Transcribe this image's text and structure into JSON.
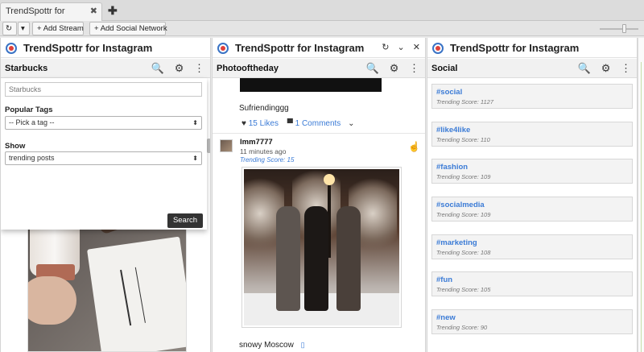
{
  "tab": {
    "label": "TrendSpottr for Instagram",
    "close": "✖",
    "add": "✚"
  },
  "toolbar": {
    "refresh": "↻",
    "dropdown": "▾",
    "add_stream": "Add Stream",
    "add_social": "Add Social Network"
  },
  "brand": {
    "title": "TrendSpottr for Instagram"
  },
  "icons": {
    "search": "🔍",
    "gear": "⚙",
    "more": "⋮",
    "refresh": "↻",
    "chevron": "⌄",
    "close": "✕",
    "plus": "+"
  },
  "col1": {
    "stream": "Starbucks",
    "search_placeholder": "Starbucks",
    "popular_tags_label": "Popular Tags",
    "tag_select": "-- Pick a tag --",
    "show_label": "Show",
    "show_select": "trending posts",
    "search_button": "Search"
  },
  "col2": {
    "stream": "Photooftheday",
    "post1": {
      "caption": "Sufriendinggg",
      "likes": "15 Likes",
      "comments": "1 Comments"
    },
    "post2": {
      "user": "lmm7777",
      "time": "11 minutes ago",
      "score": "Trending Score: 15",
      "caption": "snowy Moscow"
    }
  },
  "col3": {
    "stream": "Social",
    "tags": [
      {
        "name": "#social",
        "score": "Trending Score: 1127"
      },
      {
        "name": "#like4like",
        "score": "Trending Score: 110"
      },
      {
        "name": "#fashion",
        "score": "Trending Score: 109"
      },
      {
        "name": "#socialmedia",
        "score": "Trending Score: 109"
      },
      {
        "name": "#marketing",
        "score": "Trending Score: 108"
      },
      {
        "name": "#fun",
        "score": "Trending Score: 105"
      },
      {
        "name": "#new",
        "score": "Trending Score: 90"
      }
    ]
  },
  "colors": {
    "accent": "#3b7bd6",
    "dark_button": "#333333"
  }
}
